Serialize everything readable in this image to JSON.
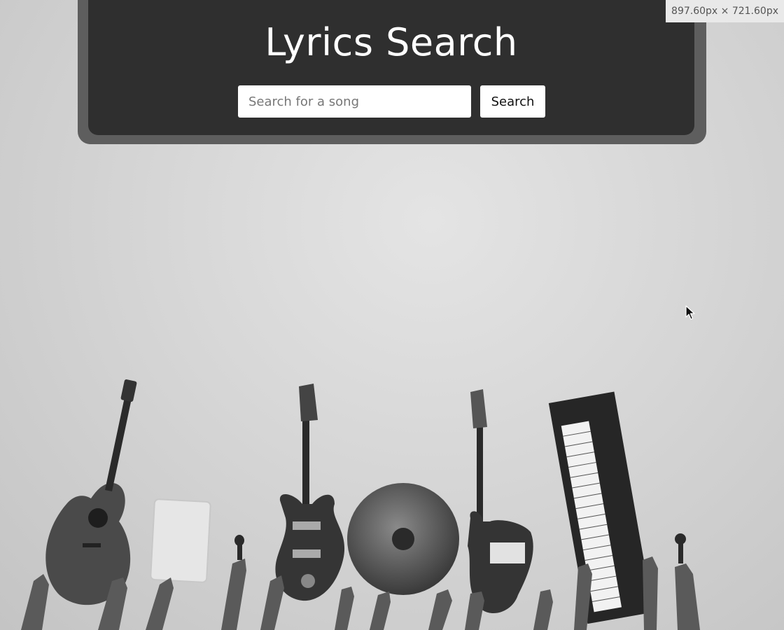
{
  "app": {
    "title": "Lyrics Search"
  },
  "search": {
    "placeholder": "Search for a song",
    "value": "",
    "button_label": "Search"
  },
  "devtools": {
    "size_readout": "897.60px × 721.60px"
  },
  "colors": {
    "header_bg": "#2f2f2f",
    "header_border": "#5e5e5e",
    "title_text": "#ffffff",
    "page_bg": "#d6d6d6"
  },
  "icons": {
    "cursor": "mouse-pointer-icon"
  }
}
